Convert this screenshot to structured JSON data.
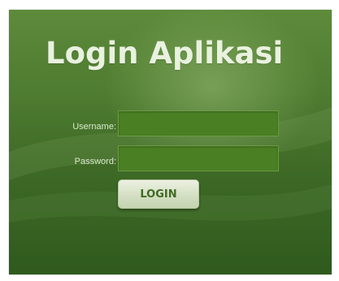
{
  "login": {
    "title": "Login Aplikasi",
    "username_label": "Username:",
    "username_value": "",
    "password_label": "Password:",
    "password_value": "",
    "login_button_label": "LOGIN"
  },
  "colors": {
    "panel_background": "#4f7d31",
    "field_background": "#4a7f24",
    "button_background": "#dde6cf",
    "button_text": "#3f6a23",
    "title_text": "#e9f1df"
  }
}
